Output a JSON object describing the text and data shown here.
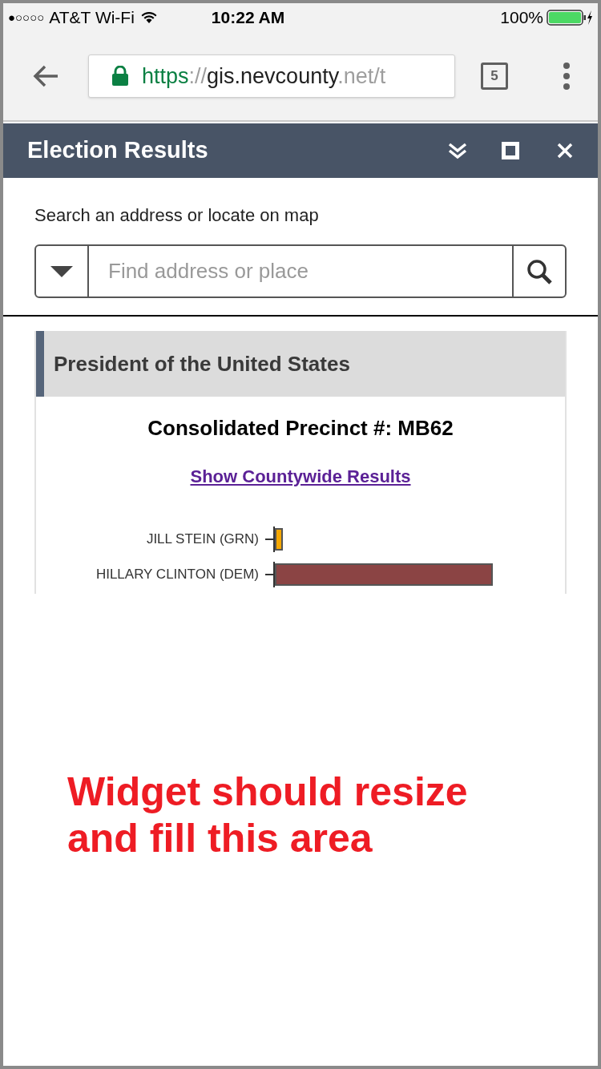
{
  "status_bar": {
    "signal": "●○○○○",
    "carrier": "AT&T Wi-Fi",
    "time": "10:22 AM",
    "battery": "100%"
  },
  "browser": {
    "url_scheme": "https",
    "url_separator": "://",
    "url_host": "gis.nevcounty",
    "url_rest": ".net/t",
    "tab_count": "5"
  },
  "widget": {
    "title": "Election Results",
    "search_label": "Search an address or locate on map",
    "search": {
      "placeholder": "Find address or place"
    },
    "section": {
      "title": "President of the United States",
      "precinct": "Consolidated Precinct #: MB62",
      "link": "Show Countywide Results",
      "candidates": [
        {
          "name": "JILL STEIN (GRN)",
          "color": "#f5a700"
        },
        {
          "name": "HILLARY CLINTON (DEM)",
          "color": "#8b4444"
        }
      ]
    }
  },
  "annotation": "Widget should resize and fill this area"
}
